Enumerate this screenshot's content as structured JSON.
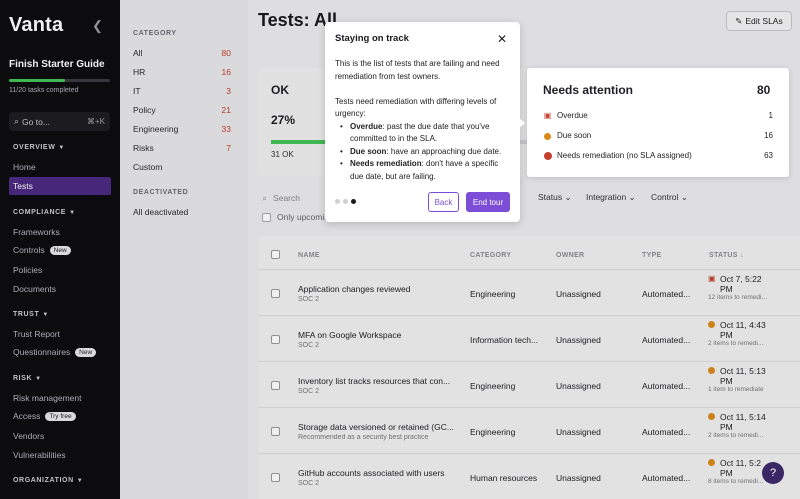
{
  "sidebar": {
    "logo": "Vanta",
    "guide_title": "Finish Starter Guide",
    "tasks_completed": "11/20 tasks completed",
    "tasks_fraction": 0.55,
    "goto_label": "Go to...",
    "goto_shortcut": "⌘+K",
    "sections": {
      "overview": "OVERVIEW",
      "compliance": "COMPLIANCE",
      "trust": "TRUST",
      "risk": "RISK",
      "organization": "ORGANIZATION"
    },
    "items": {
      "home": "Home",
      "tests": "Tests",
      "frameworks": "Frameworks",
      "controls": "Controls",
      "controls_badge": "New",
      "policies": "Policies",
      "documents": "Documents",
      "trust_report": "Trust Report",
      "questionnaires": "Questionnaires",
      "questionnaires_badge": "New",
      "risk_management": "Risk management",
      "access": "Access",
      "access_badge": "Try free",
      "vendors": "Vendors",
      "vulnerabilities": "Vulnerabilities"
    }
  },
  "categories": {
    "label": "CATEGORY",
    "items": [
      {
        "label": "All",
        "count": "80"
      },
      {
        "label": "HR",
        "count": "16"
      },
      {
        "label": "IT",
        "count": "3"
      },
      {
        "label": "Policy",
        "count": "21"
      },
      {
        "label": "Engineering",
        "count": "33"
      },
      {
        "label": "Risks",
        "count": "7"
      },
      {
        "label": "Custom",
        "count": ""
      }
    ],
    "deactivated_label": "DEACTIVATED",
    "all_deactivated": "All deactivated"
  },
  "header": {
    "title": "Tests: All",
    "edit_sla": "Edit SLAs"
  },
  "ok_card": {
    "title": "OK",
    "percent": "27%",
    "fraction": 0.27,
    "count": "31 OK"
  },
  "filters": {
    "search_placeholder": "Search",
    "upcoming": "Only upcoming",
    "status": "Status",
    "integration": "Integration",
    "control": "Control"
  },
  "table": {
    "headers": {
      "name": "NAME",
      "category": "CATEGORY",
      "owner": "OWNER",
      "type": "TYPE",
      "status": "STATUS"
    },
    "rows": [
      {
        "name": "Application changes reviewed",
        "sub": "SOC 2",
        "category": "Engineering",
        "owner": "Unassigned",
        "type": "Automated...",
        "status_icon": "calendar",
        "status_l1": "Oct 7, 5:22",
        "status_l2": "PM",
        "remediate": "12 items to remedi..."
      },
      {
        "name": "MFA on Google Workspace",
        "sub": "SOC 2",
        "category": "Information tech...",
        "owner": "Unassigned",
        "type": "Automated...",
        "status_icon": "clock",
        "status_l1": "Oct 11, 4:43",
        "status_l2": "PM",
        "remediate": "2 items to remedi..."
      },
      {
        "name": "Inventory list tracks resources that con...",
        "sub": "SOC 2",
        "category": "Engineering",
        "owner": "Unassigned",
        "type": "Automated...",
        "status_icon": "clock",
        "status_l1": "Oct 11, 5:13",
        "status_l2": "PM",
        "remediate": "1 item to remediate"
      },
      {
        "name": "Storage data versioned or retained (GC...",
        "sub": "Recommended as a security best practice",
        "category": "Engineering",
        "owner": "Unassigned",
        "type": "Automated...",
        "status_icon": "clock",
        "status_l1": "Oct 11, 5:14",
        "status_l2": "PM",
        "remediate": "2 items to remedi..."
      },
      {
        "name": "GitHub accounts associated with users",
        "sub": "SOC 2",
        "category": "Human resources",
        "owner": "Unassigned",
        "type": "Automated...",
        "status_icon": "clock",
        "status_l1": "Oct 11, 5:2",
        "status_l2": "PM",
        "remediate": "8 items to remedi..."
      }
    ]
  },
  "tour": {
    "title": "Staying on track",
    "p1": "This is the list of tests that are failing and need remediation from test owners.",
    "p2": "Tests need remediation with differing levels of urgency:",
    "bullets": [
      {
        "term": "Overdue",
        "text": ": past the due date that you've committed to in the SLA."
      },
      {
        "term": "Due soon",
        "text": ": have an approaching due date."
      },
      {
        "term": "Needs remediation",
        "text": ": don't have a specific due date, but are failing."
      }
    ],
    "back": "Back",
    "end": "End tour"
  },
  "attention": {
    "title": "Needs attention",
    "total": "80",
    "rows": [
      {
        "label": "Overdue",
        "value": "1"
      },
      {
        "label": "Due soon",
        "value": "16"
      },
      {
        "label": "Needs remediation (no SLA assigned)",
        "value": "63"
      }
    ]
  },
  "colors": {
    "accent": "#7c4dd6",
    "sidebar_active": "#4b2a82",
    "success": "#46c35a",
    "danger": "#c4402f",
    "warning": "#d98b1a"
  }
}
